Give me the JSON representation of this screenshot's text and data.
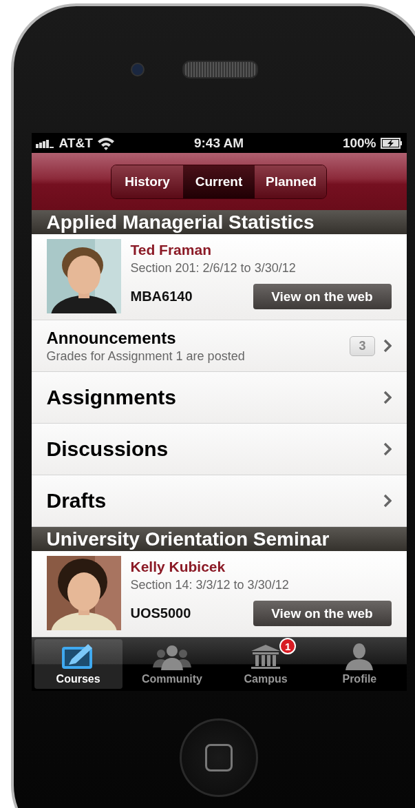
{
  "status_bar": {
    "carrier": "AT&T",
    "time": "9:43 AM",
    "battery": "100%"
  },
  "segments": [
    {
      "label": "History",
      "selected": false
    },
    {
      "label": "Current",
      "selected": true
    },
    {
      "label": "Planned",
      "selected": false
    }
  ],
  "courses": [
    {
      "title": "Applied Managerial Statistics",
      "instructor": "Ted Framan",
      "section": "Section 201: 2/6/12 to 3/30/12",
      "code": "MBA6140",
      "button": "View on the web",
      "items": [
        {
          "kind": "announcement",
          "title": "Announcements",
          "subtitle": "Grades for Assignment 1 are posted",
          "count": "3"
        },
        {
          "kind": "link",
          "title": "Assignments"
        },
        {
          "kind": "link",
          "title": "Discussions"
        },
        {
          "kind": "link",
          "title": "Drafts"
        }
      ]
    },
    {
      "title": "University Orientation Seminar",
      "instructor": "Kelly Kubicek",
      "section": "Section 14: 3/3/12 to 3/30/12",
      "code": "UOS5000",
      "button": "View on the web"
    }
  ],
  "tab_bar": [
    {
      "label": "Courses",
      "selected": true
    },
    {
      "label": "Community",
      "selected": false
    },
    {
      "label": "Campus",
      "selected": false,
      "badge": "1"
    },
    {
      "label": "Profile",
      "selected": false
    }
  ]
}
